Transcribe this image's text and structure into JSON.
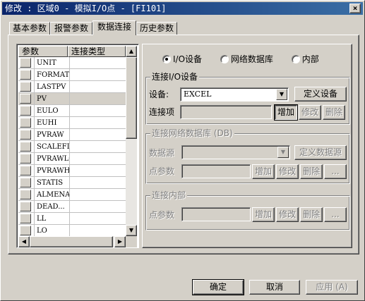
{
  "window": {
    "title": "修改 : 区域0 - 模拟I/O点 - [FI101]",
    "close_symbol": "×"
  },
  "tabs": [
    {
      "label": "基本参数"
    },
    {
      "label": "报警参数"
    },
    {
      "label": "数据连接"
    },
    {
      "label": "历史参数"
    }
  ],
  "param_list": {
    "headers": {
      "param": "参数",
      "conn_type": "连接类型"
    },
    "rows": [
      {
        "name": "UNIT",
        "type": ""
      },
      {
        "name": "FORMAT",
        "type": ""
      },
      {
        "name": "LASTPV",
        "type": ""
      },
      {
        "name": "PV",
        "type": ""
      },
      {
        "name": "EULO",
        "type": ""
      },
      {
        "name": "EUHI",
        "type": ""
      },
      {
        "name": "PVRAW",
        "type": ""
      },
      {
        "name": "SCALEFL",
        "type": ""
      },
      {
        "name": "PVRAWLO",
        "type": ""
      },
      {
        "name": "PVRAWHI",
        "type": ""
      },
      {
        "name": "STATIS",
        "type": ""
      },
      {
        "name": "ALMENAB",
        "type": ""
      },
      {
        "name": "DEAD...",
        "type": ""
      },
      {
        "name": "LL",
        "type": ""
      },
      {
        "name": "LO",
        "type": ""
      }
    ],
    "selected_index": 3
  },
  "source": {
    "options": [
      "I/O设备",
      "网络数据库",
      "内部"
    ],
    "selected_index": 0
  },
  "io_group": {
    "title": "连接I/O设备",
    "device_label": "设备:",
    "device_value": "EXCEL",
    "define_device": "定义设备",
    "item_label": "连接项",
    "add": "增加",
    "modify": "修改",
    "delete": "删除"
  },
  "db_group": {
    "title": "连接网络数据库 (DB)",
    "source_label": "数据源",
    "define_source": "定义数据源",
    "param_label": "点参数",
    "add": "增加",
    "modify": "修改",
    "delete": "删除",
    "browse": "..."
  },
  "internal_group": {
    "title": "连接内部",
    "param_label": "点参数",
    "add": "增加",
    "modify": "修改",
    "delete": "删除",
    "browse": "..."
  },
  "footer": {
    "ok": "确定",
    "cancel": "取消",
    "apply": "应用 (A)"
  },
  "icons": {
    "dropdown": "▼",
    "scroll_up": "▲",
    "scroll_down": "▼",
    "scroll_left": "◀",
    "scroll_right": "▶"
  }
}
